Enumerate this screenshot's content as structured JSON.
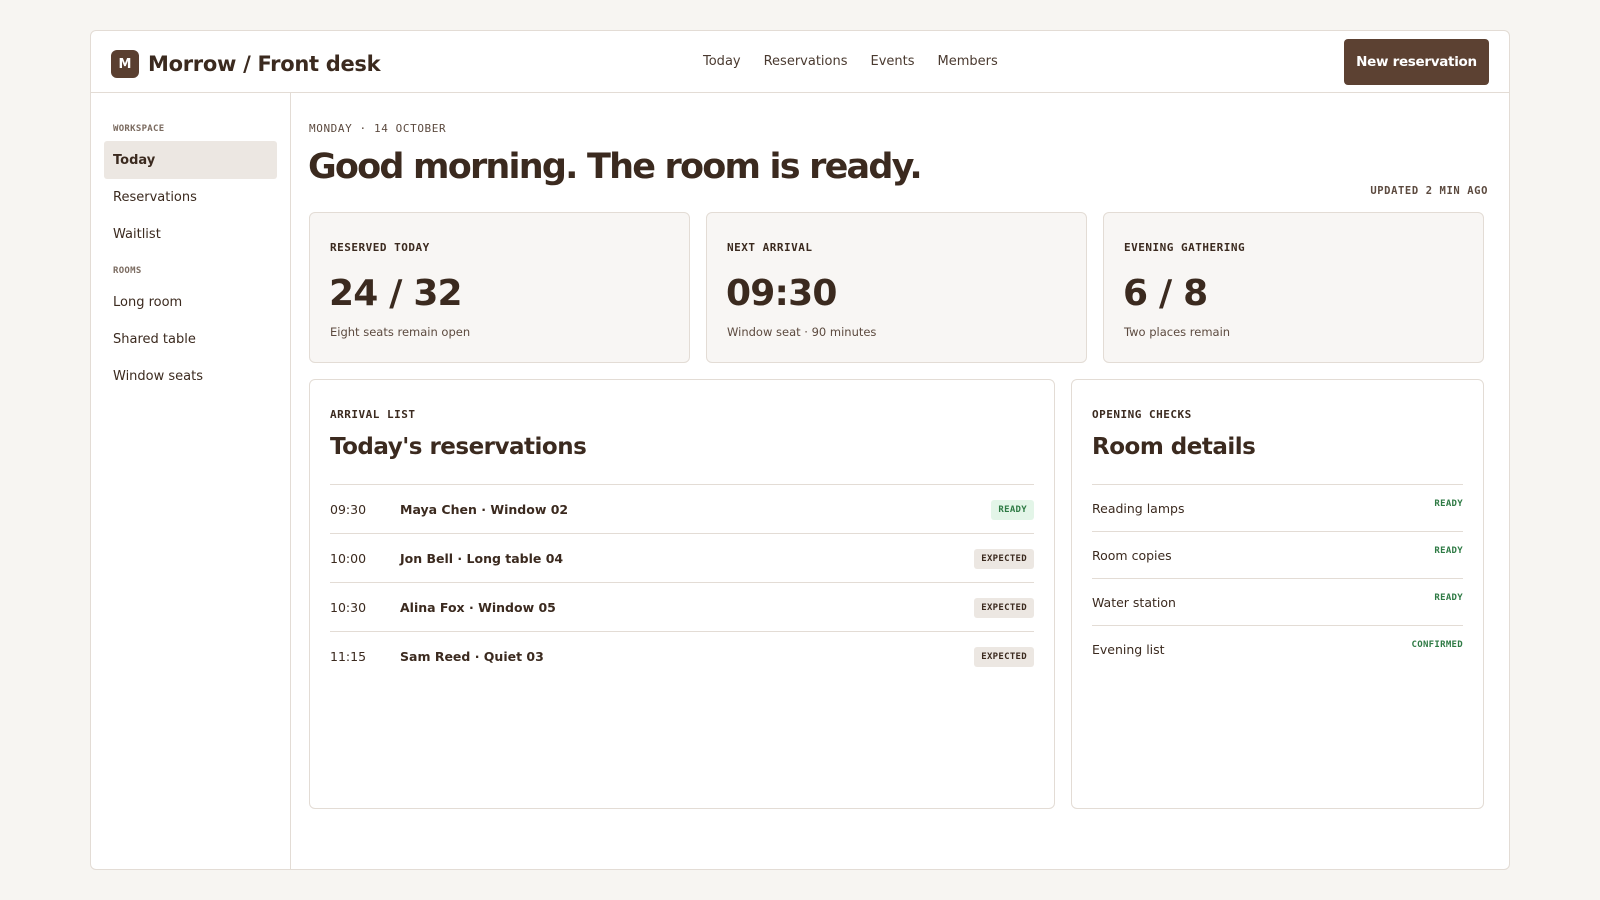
{
  "header": {
    "logo_letter": "M",
    "title": "Morrow / Front desk",
    "nav": [
      "Today",
      "Reservations",
      "Events",
      "Members"
    ],
    "primary_action": "New reservation"
  },
  "sidebar": {
    "sections": [
      {
        "label": "WORKSPACE",
        "items": [
          "Today",
          "Reservations",
          "Waitlist"
        ]
      },
      {
        "label": "ROOMS",
        "items": [
          "Long room",
          "Shared table",
          "Window seats"
        ]
      }
    ],
    "active_item": "Today"
  },
  "main": {
    "date": "MONDAY · 14 OCTOBER",
    "greeting": "Good morning. The room is ready.",
    "updated": "UPDATED 2 MIN AGO",
    "stats": [
      {
        "label": "RESERVED TODAY",
        "value": "24 / 32",
        "sub": "Eight seats remain open"
      },
      {
        "label": "NEXT ARRIVAL",
        "value": "09:30",
        "sub": "Window seat · 90 minutes"
      },
      {
        "label": "EVENING GATHERING",
        "value": "6 / 8",
        "sub": "Two places remain"
      }
    ],
    "arrivals": {
      "eyebrow": "ARRIVAL LIST",
      "title": "Today's reservations",
      "rows": [
        {
          "time": "09:30",
          "name": "Maya Chen · Window 02",
          "status": "READY"
        },
        {
          "time": "10:00",
          "name": "Jon Bell · Long table 04",
          "status": "EXPECTED"
        },
        {
          "time": "10:30",
          "name": "Alina Fox · Window 05",
          "status": "EXPECTED"
        },
        {
          "time": "11:15",
          "name": "Sam Reed · Quiet 03",
          "status": "EXPECTED"
        }
      ]
    },
    "checks": {
      "eyebrow": "OPENING CHECKS",
      "title": "Room details",
      "rows": [
        {
          "name": "Reading lamps",
          "status": "READY"
        },
        {
          "name": "Room copies",
          "status": "READY"
        },
        {
          "name": "Water station",
          "status": "READY"
        },
        {
          "name": "Evening list",
          "status": "CONFIRMED"
        }
      ]
    }
  },
  "colors": {
    "brand": "#5c4132",
    "text": "#3b2a1f",
    "border": "#e3dcd5",
    "ready_bg": "#e3f5e8",
    "ready_text": "#2e7a44",
    "expected_bg": "#ece7e2"
  }
}
